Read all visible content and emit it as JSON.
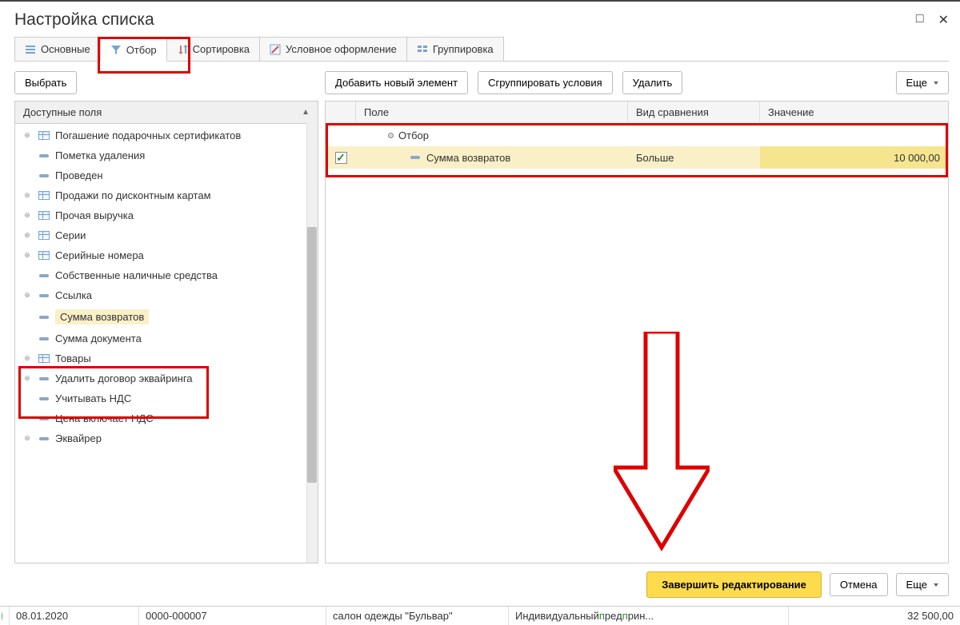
{
  "window": {
    "title": "Настройка списка"
  },
  "tabs": [
    {
      "label": "Основные",
      "active": false,
      "icon": "list"
    },
    {
      "label": "Отбор",
      "active": true,
      "icon": "filter"
    },
    {
      "label": "Сортировка",
      "active": false,
      "icon": "sort"
    },
    {
      "label": "Условное оформление",
      "active": false,
      "icon": "format"
    },
    {
      "label": "Группировка",
      "active": false,
      "icon": "group"
    }
  ],
  "left": {
    "select_btn": "Выбрать",
    "fields_header": "Доступные поля",
    "fields": [
      {
        "label": "Погашение подарочных сертификатов",
        "expand": true,
        "icon": "table"
      },
      {
        "label": "Пометка удаления",
        "expand": false,
        "icon": "dash"
      },
      {
        "label": "Проведен",
        "expand": false,
        "icon": "dash"
      },
      {
        "label": "Продажи по дисконтным картам",
        "expand": true,
        "icon": "table"
      },
      {
        "label": "Прочая выручка",
        "expand": true,
        "icon": "table"
      },
      {
        "label": "Серии",
        "expand": true,
        "icon": "table"
      },
      {
        "label": "Серийные номера",
        "expand": true,
        "icon": "table"
      },
      {
        "label": "Собственные наличные средства",
        "expand": false,
        "icon": "dash"
      },
      {
        "label": "Ссылка",
        "expand": true,
        "icon": "dash"
      },
      {
        "label": "Сумма возвратов",
        "expand": false,
        "icon": "dash",
        "selected": true
      },
      {
        "label": "Сумма документа",
        "expand": false,
        "icon": "dash"
      },
      {
        "label": "Товары",
        "expand": true,
        "icon": "table"
      },
      {
        "label": "Удалить договор эквайринга",
        "expand": true,
        "icon": "dash"
      },
      {
        "label": "Учитывать НДС",
        "expand": false,
        "icon": "dash"
      },
      {
        "label": "Цена включает НДС",
        "expand": false,
        "icon": "dash"
      },
      {
        "label": "Эквайрер",
        "expand": true,
        "icon": "dash"
      }
    ]
  },
  "right": {
    "add_btn": "Добавить новый элемент",
    "group_btn": "Сгруппировать условия",
    "delete_btn": "Удалить",
    "more_btn": "Еще",
    "headers": {
      "field": "Поле",
      "comparison": "Вид сравнения",
      "value": "Значение"
    },
    "group_label": "Отбор",
    "row": {
      "checked": true,
      "field": "Сумма возвратов",
      "comparison": "Больше",
      "value": "10 000,00"
    }
  },
  "footer": {
    "finish": "Завершить редактирование",
    "cancel": "Отмена",
    "more": "Еще"
  },
  "statusbar": {
    "date": "08.01.2020",
    "docnum": "0000-000007",
    "org": "салон одежды \"Бульвар\"",
    "counterparty_prefix": "Индивидуальный ",
    "counterparty_hl": "п",
    "counterparty_mid": "ред",
    "counterparty_hl2": "п",
    "counterparty_suffix": "рин...",
    "amount": "32 500,00"
  }
}
